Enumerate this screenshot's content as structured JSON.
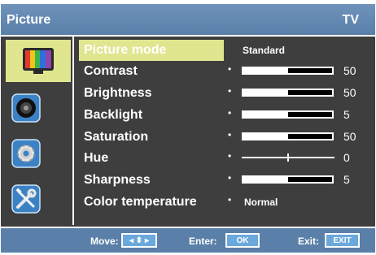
{
  "header": {
    "title": "Picture",
    "source": "TV"
  },
  "sidebar": {
    "items": [
      {
        "icon": "picture-icon",
        "active": true
      },
      {
        "icon": "sound-icon",
        "active": false
      },
      {
        "icon": "setup-icon",
        "active": false
      },
      {
        "icon": "tools-icon",
        "active": false
      }
    ]
  },
  "menu": {
    "picture_mode": {
      "label": "Picture mode",
      "value": "Standard"
    },
    "contrast": {
      "label": "Contrast",
      "value": "50",
      "level": 0.5
    },
    "brightness": {
      "label": "Brightness",
      "value": "50",
      "level": 0.5
    },
    "backlight": {
      "label": "Backlight",
      "value": "5",
      "level": 0.5
    },
    "saturation": {
      "label": "Saturation",
      "value": "50",
      "level": 0.5
    },
    "hue": {
      "label": "Hue",
      "value": "0",
      "level": 0.5
    },
    "sharpness": {
      "label": "Sharpness",
      "value": "5",
      "level": 0.5
    },
    "color_temperature": {
      "label": "Color temperature",
      "value": "Normal"
    }
  },
  "footer": {
    "move_label": "Move:",
    "move_button": "◂ ⬍ ▸",
    "enter_label": "Enter:",
    "enter_button": "OK",
    "exit_label": "Exit:",
    "exit_button": "EXIT"
  },
  "colors": {
    "header_blue": "#5a7fa8",
    "highlight": "#e0e58f",
    "panel": "#3e3e3e",
    "button_blue": "#6ba8dc"
  }
}
